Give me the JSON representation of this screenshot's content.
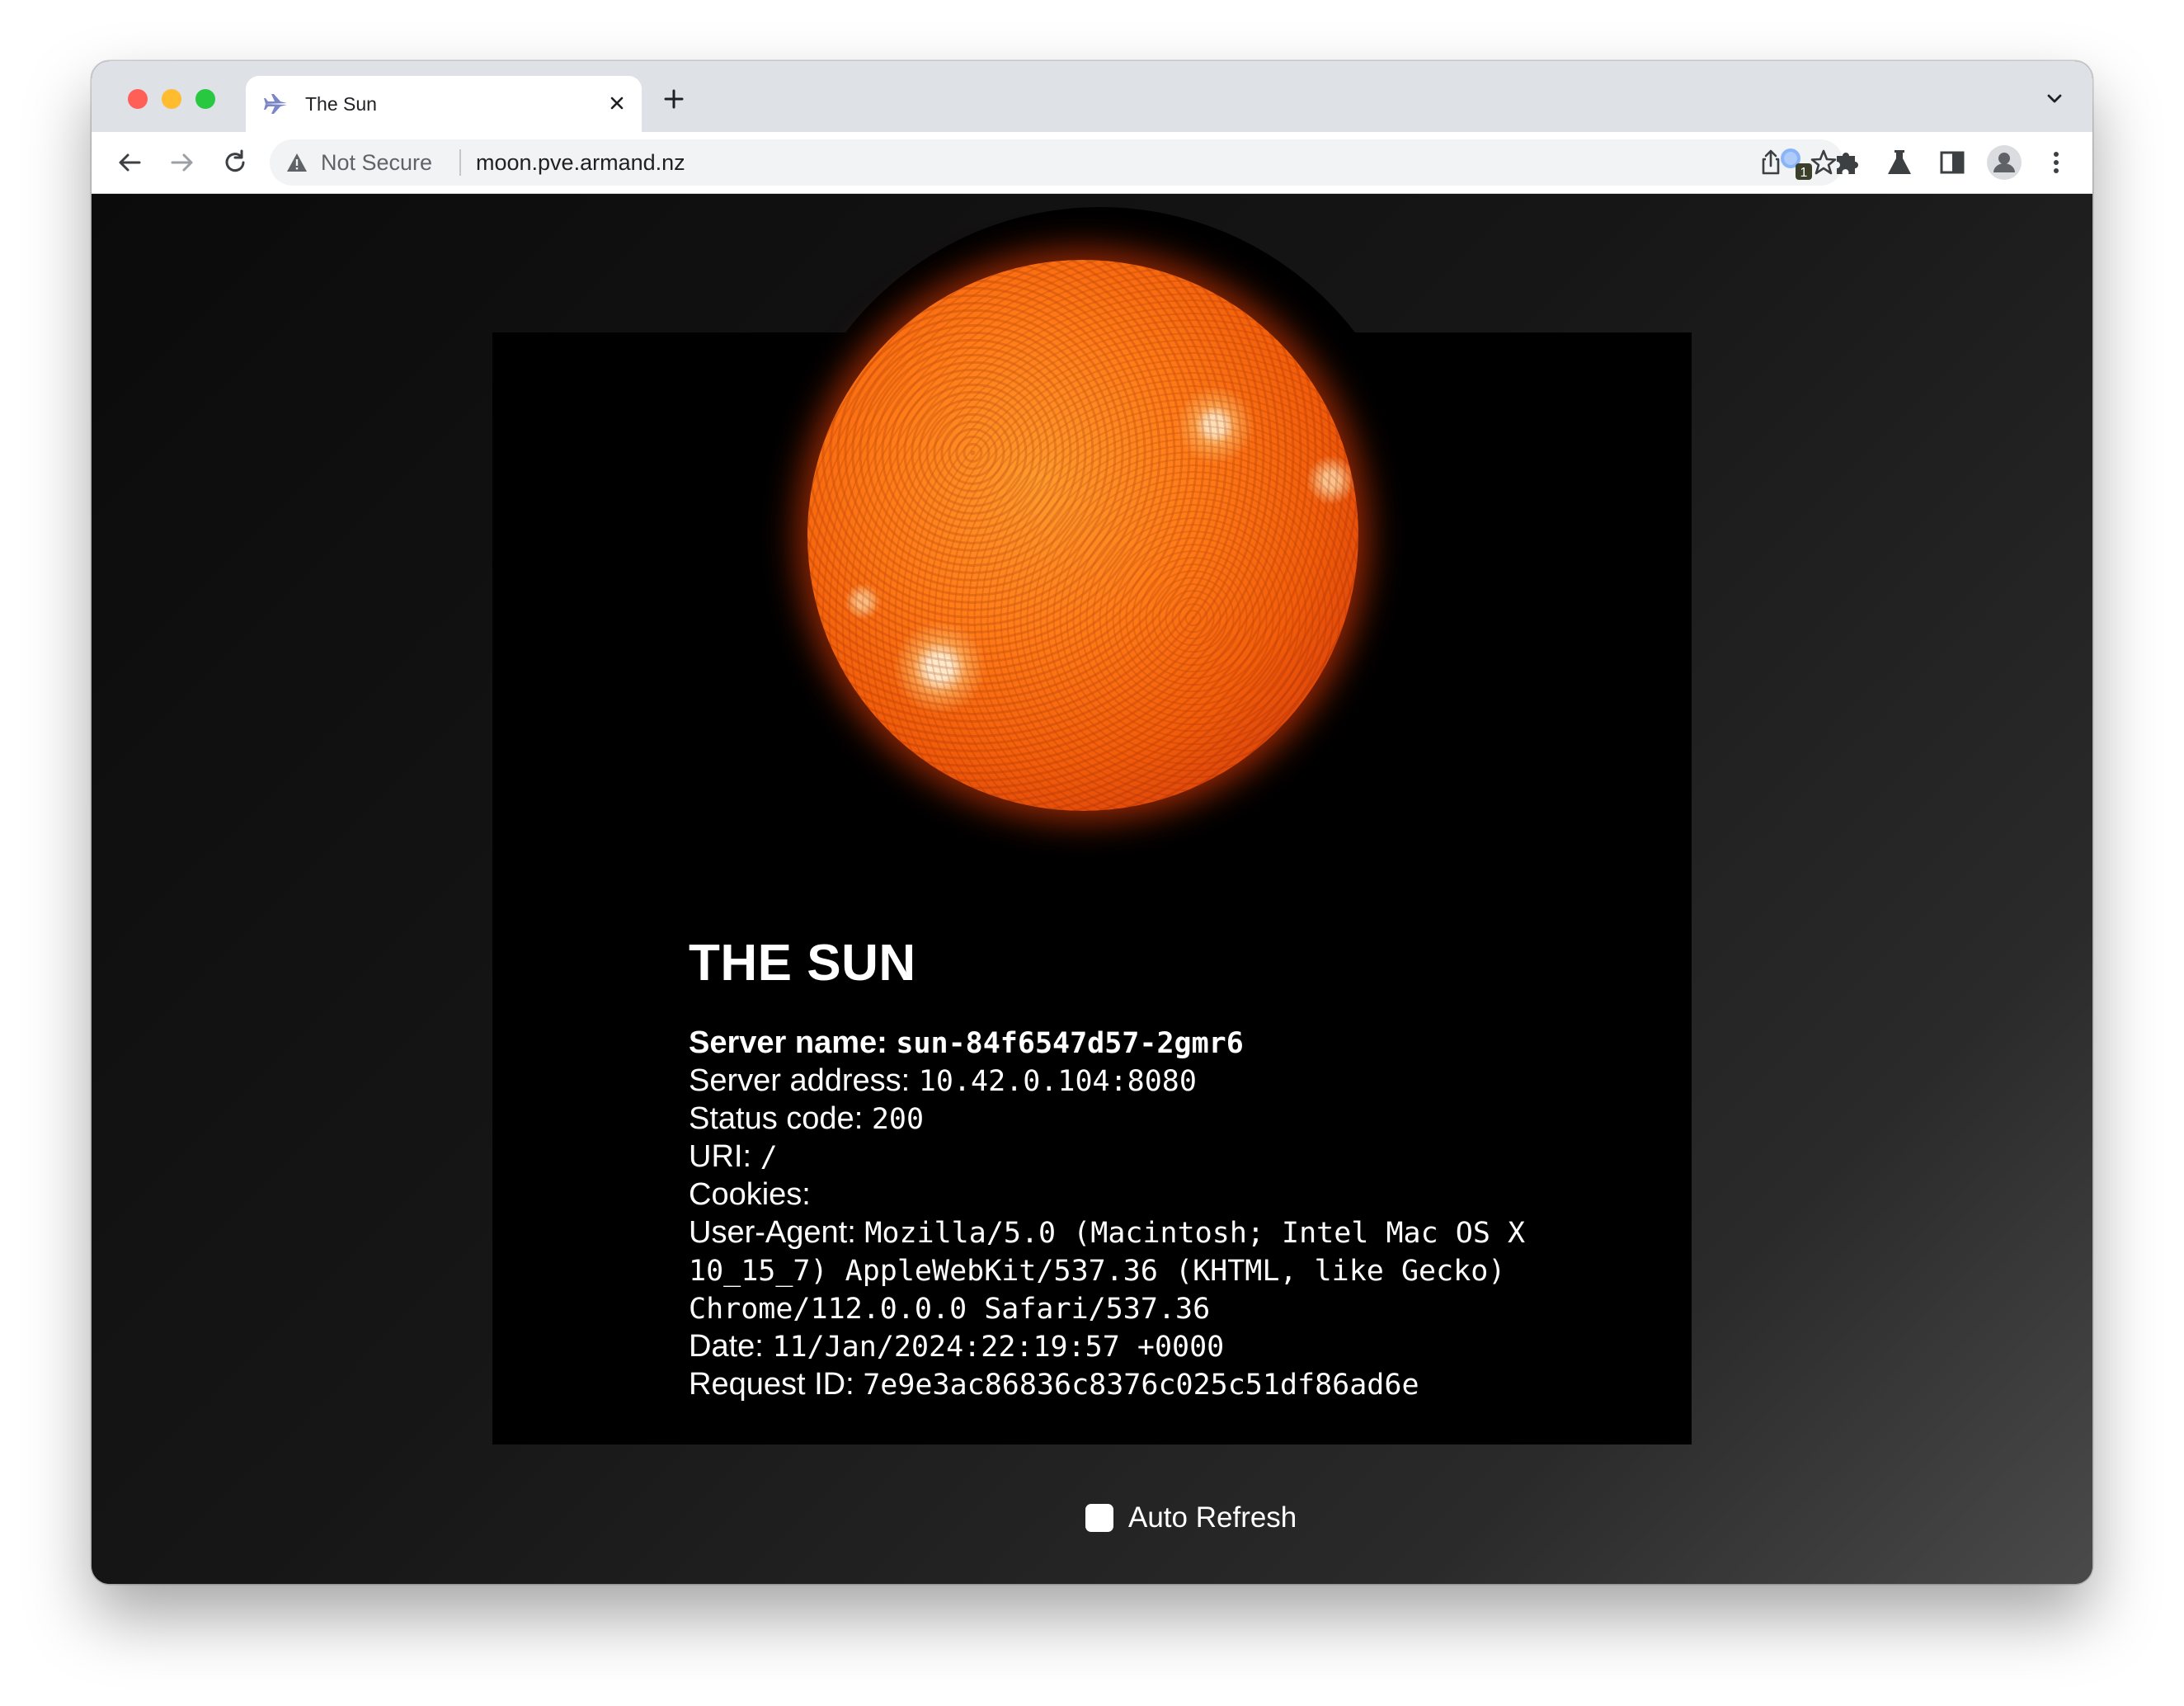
{
  "browser": {
    "tab": {
      "title": "The Sun",
      "favicon": "jet-plane-icon"
    },
    "address_bar": {
      "security_label": "Not Secure",
      "url": "moon.pve.armand.nz"
    },
    "extension_badge": "1",
    "icons": [
      "back-arrow-icon",
      "forward-arrow-icon",
      "reload-icon",
      "share-icon",
      "bookmark-star-icon",
      "extension-icon",
      "puzzle-icon",
      "labs-flask-icon",
      "side-panel-icon",
      "profile-icon",
      "menu-dots-icon"
    ]
  },
  "page": {
    "heading": "THE SUN",
    "fields": {
      "server_name": {
        "label": "Server name:",
        "value": "sun-84f6547d57-2gmr6"
      },
      "server_address": {
        "label": "Server address:",
        "value": "10.42.0.104:8080"
      },
      "status_code": {
        "label": "Status code:",
        "value": "200"
      },
      "uri": {
        "label": "URI:",
        "value": "/"
      },
      "cookies": {
        "label": "Cookies:",
        "value": ""
      },
      "user_agent": {
        "label": "User-Agent:",
        "value": "Mozilla/5.0 (Macintosh; Intel Mac OS X 10_15_7) AppleWebKit/537.36 (KHTML, like Gecko) Chrome/112.0.0.0 Safari/537.36"
      },
      "date": {
        "label": "Date:",
        "value": "11/Jan/2024:22:19:57 +0000"
      },
      "request_id": {
        "label": "Request ID:",
        "value": "7e9e3ac86836c8376c025c51df86ad6e"
      }
    },
    "auto_refresh": {
      "label": "Auto Refresh",
      "checked": false
    }
  }
}
